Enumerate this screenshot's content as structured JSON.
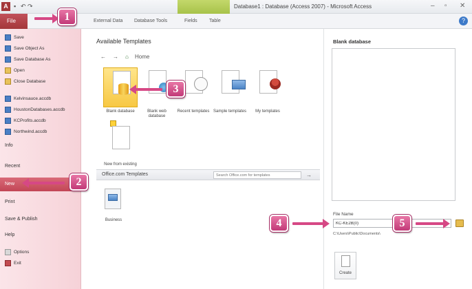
{
  "app": {
    "logo_letter": "A",
    "window_title": "Database1 : Database (Access 2007) - Microsoft Access",
    "minimize_glyph": "–",
    "maximize_glyph": "▫",
    "close_glyph": "✕"
  },
  "ribbon": {
    "file_tab": "File",
    "tabs": [
      "External Data",
      "Database Tools",
      "Fields",
      "Table"
    ],
    "help_glyph": "?"
  },
  "nav": {
    "small_items": [
      {
        "label": "Save",
        "icon": "save-icon"
      },
      {
        "label": "Save Object As",
        "icon": "save-object-icon"
      },
      {
        "label": "Save Database As",
        "icon": "save-database-icon"
      },
      {
        "label": "Open",
        "icon": "open-folder-icon"
      },
      {
        "label": "Close Database",
        "icon": "close-database-icon"
      },
      {
        "label": "Kelvinsauce.accdb",
        "icon": "database-file-icon"
      },
      {
        "label": "HoustonDatabases.accdb",
        "icon": "database-file-icon"
      },
      {
        "label": "KCProfits.accdb",
        "icon": "database-file-icon"
      },
      {
        "label": "Northwind.accdb",
        "icon": "database-file-icon"
      }
    ],
    "big_items": [
      "Info",
      "Recent",
      "New",
      "Print",
      "Save & Publish",
      "Help"
    ],
    "bottom_items": [
      {
        "label": "Options",
        "icon": "options-icon"
      },
      {
        "label": "Exit",
        "icon": "exit-icon"
      }
    ]
  },
  "templates": {
    "heading": "Available Templates",
    "back_glyph": "←",
    "forward_glyph": "→",
    "home_glyph": "⌂",
    "home_label": "Home",
    "tiles": [
      {
        "label": "Blank database",
        "icon": "blank-database-icon"
      },
      {
        "label": "Blank web database",
        "icon": "blank-web-database-icon"
      },
      {
        "label": "Recent templates",
        "icon": "recent-templates-icon"
      },
      {
        "label": "Sample templates",
        "icon": "sample-templates-icon"
      },
      {
        "label": "My templates",
        "icon": "my-templates-icon"
      },
      {
        "label": "New from existing",
        "icon": "new-from-existing-icon"
      }
    ],
    "officecom_label": "Office.com Templates",
    "search_placeholder": "Search Office.com for templates",
    "search_go": "→",
    "business_label": "Business"
  },
  "right": {
    "title": "Blank database",
    "file_name_label": "File Name",
    "file_name_value": "KC-KE2B(0)",
    "path": "C:\\Users\\Public\\Documents\\",
    "create_label": "Create"
  },
  "callouts": [
    "1",
    "2",
    "3",
    "4",
    "5"
  ]
}
